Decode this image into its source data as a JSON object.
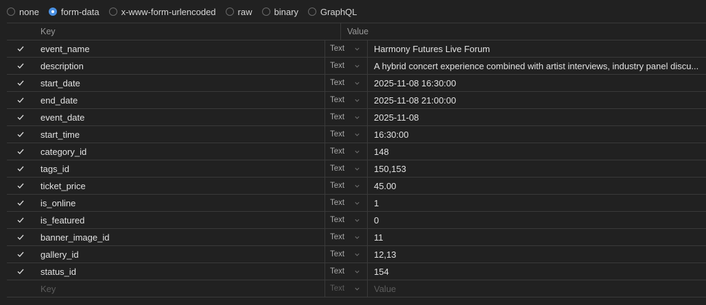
{
  "body_types": [
    {
      "label": "none",
      "selected": false
    },
    {
      "label": "form-data",
      "selected": true
    },
    {
      "label": "x-www-form-urlencoded",
      "selected": false
    },
    {
      "label": "raw",
      "selected": false
    },
    {
      "label": "binary",
      "selected": false
    },
    {
      "label": "GraphQL",
      "selected": false
    }
  ],
  "table": {
    "header_key": "Key",
    "header_value": "Value",
    "rows": [
      {
        "key": "event_name",
        "type": "Text",
        "value": "Harmony Futures Live Forum"
      },
      {
        "key": "description",
        "type": "Text",
        "value": "A hybrid concert experience combined with artist interviews, industry panel discu..."
      },
      {
        "key": "start_date",
        "type": "Text",
        "value": "2025-11-08 16:30:00"
      },
      {
        "key": "end_date",
        "type": "Text",
        "value": "2025-11-08 21:00:00"
      },
      {
        "key": "event_date",
        "type": "Text",
        "value": "2025-11-08"
      },
      {
        "key": "start_time",
        "type": "Text",
        "value": "16:30:00"
      },
      {
        "key": "category_id",
        "type": "Text",
        "value": "148"
      },
      {
        "key": "tags_id",
        "type": "Text",
        "value": "150,153"
      },
      {
        "key": "ticket_price",
        "type": "Text",
        "value": "45.00"
      },
      {
        "key": "is_online",
        "type": "Text",
        "value": "1"
      },
      {
        "key": "is_featured",
        "type": "Text",
        "value": "0"
      },
      {
        "key": "banner_image_id",
        "type": "Text",
        "value": "11"
      },
      {
        "key": "gallery_id",
        "type": "Text",
        "value": "12,13"
      },
      {
        "key": "status_id",
        "type": "Text",
        "value": "154"
      }
    ],
    "empty_row": {
      "key_placeholder": "Key",
      "type": "Text",
      "value_placeholder": "Value"
    }
  },
  "colors": {
    "accent": "#4a90e2",
    "background": "#212121",
    "border": "#3a3a3a"
  },
  "icons": {
    "check": "check-icon",
    "chevron": "chevron-down-icon"
  }
}
